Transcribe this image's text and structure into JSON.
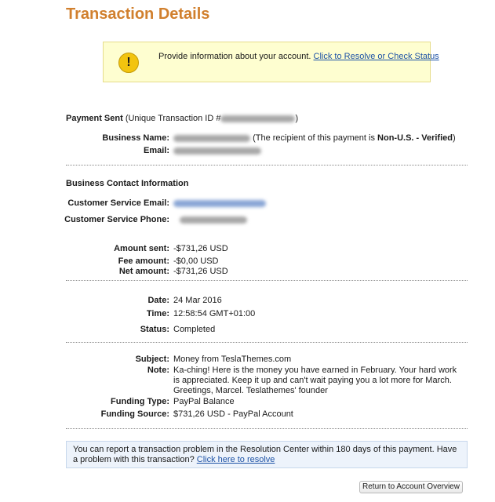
{
  "title": "Transaction Details",
  "notice": {
    "text": "Provide information about your account.",
    "link": "Click to Resolve or Check Status"
  },
  "payment": {
    "heading": "Payment Sent",
    "id_label": "(Unique Transaction ID #",
    "id_close": ")",
    "business_name_label": "Business Name:",
    "recipient_note_prefix": "(The recipient of this payment is ",
    "recipient_status": "Non-U.S. - Verified",
    "recipient_note_suffix": ")",
    "email_label": "Email:"
  },
  "contact": {
    "heading": "Business Contact Information",
    "cs_email_label": "Customer Service Email:",
    "cs_phone_label": "Customer Service Phone:"
  },
  "amounts": {
    "sent_label": "Amount sent:",
    "sent_value": "-$731,26 USD",
    "fee_label": "Fee amount:",
    "fee_value": "-$0,00 USD",
    "net_label": "Net amount:",
    "net_value": "-$731,26 USD"
  },
  "status": {
    "date_label": "Date:",
    "date_value": "24 Mar 2016",
    "time_label": "Time:",
    "time_value": "12:58:54 GMT+01:00",
    "status_label": "Status:",
    "status_value": "Completed"
  },
  "details": {
    "subject_label": "Subject:",
    "subject_value": "Money from TeslaThemes.com",
    "note_label": "Note:",
    "note_value": "Ka-ching! Here is the money you have earned in February. Your hard work is appreciated. Keep it up and can't wait paying you a lot more for March. Greetings, Marcel. Teslathemes' founder",
    "funding_type_label": "Funding Type:",
    "funding_type_value": "PayPal Balance",
    "funding_source_label": "Funding Source:",
    "funding_source_value": "$731,26 USD - PayPal Account"
  },
  "footer": {
    "text": "You can report a transaction problem in the Resolution Center within 180 days of this payment. Have a problem with this transaction?",
    "link": "Click here to resolve"
  },
  "return_button": "Return to Account Overview",
  "colors": {
    "title": "#d1802e",
    "link": "#1e53a6",
    "notice_bg": "#fefed0",
    "footer_bg": "#edf3fb"
  },
  "icons": {
    "notice": "exclamation-icon"
  }
}
